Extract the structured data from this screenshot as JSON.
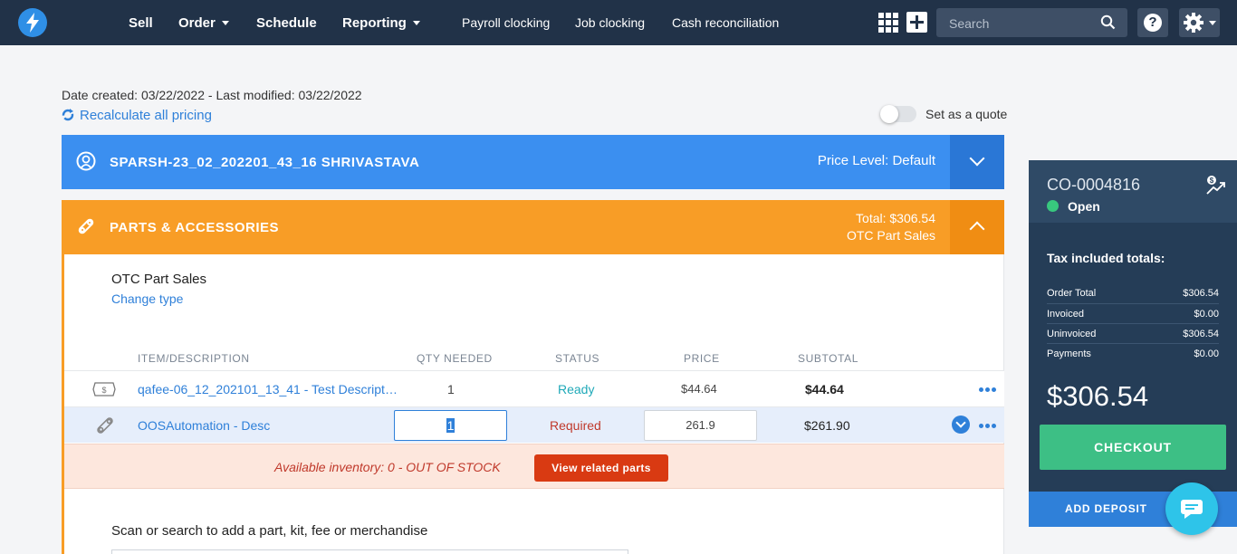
{
  "nav": {
    "main": [
      {
        "label": "Sell",
        "dropdown": false
      },
      {
        "label": "Order",
        "dropdown": true
      },
      {
        "label": "Schedule",
        "dropdown": false
      },
      {
        "label": "Reporting",
        "dropdown": true
      }
    ],
    "secondary": [
      "Payroll clocking",
      "Job clocking",
      "Cash reconciliation"
    ],
    "search_placeholder": "Search",
    "help_label": "?",
    "icons": [
      "lightning-logo-icon",
      "apps-grid-icon",
      "plus-icon",
      "search-icon",
      "help-icon",
      "gear-icon"
    ]
  },
  "meta": {
    "dates": "Date created: 03/22/2022 - Last modified: 03/22/2022",
    "recalculate": "Recalculate all pricing",
    "quote_label": "Set as a quote",
    "quote_enabled": false
  },
  "customer": {
    "name": "SPARSH-23_02_202201_43_16 SHRIVASTAVA",
    "price_level": "Price Level: Default"
  },
  "parts": {
    "title": "PARTS & ACCESSORIES",
    "total": "Total: $306.54",
    "sale_type": "OTC Part Sales",
    "type_title": "OTC Part Sales",
    "change_type": "Change type",
    "columns": [
      "ITEM/DESCRIPTION",
      "QTY NEEDED",
      "STATUS",
      "PRICE",
      "SUBTOTAL"
    ],
    "rows": [
      {
        "item": "qafee-06_12_202101_13_41 - Test Descript…",
        "qty": "1",
        "status": "Ready",
        "price": "$44.64",
        "subtotal": "$44.64"
      },
      {
        "item": "OOSAutomation - Desc",
        "qty": "1",
        "status": "Required",
        "price": "261.9",
        "subtotal": "$261.90"
      }
    ],
    "inventory_warning": "Available inventory: 0 - OUT OF STOCK",
    "related_button": "View related parts",
    "scan_label": "Scan or search to add a part, kit, fee or merchandise"
  },
  "order": {
    "id": "CO-0004816",
    "status": "Open",
    "tax_title": "Tax included totals:",
    "totals": [
      {
        "label": "Order Total",
        "value": "$306.54"
      },
      {
        "label": "Invoiced",
        "value": "$0.00"
      },
      {
        "label": "Uninvoiced",
        "value": "$306.54"
      },
      {
        "label": "Payments",
        "value": "$0.00"
      }
    ],
    "grand_total": "$306.54",
    "checkout": "CHECKOUT",
    "add_deposit": "ADD DEPOSIT"
  },
  "colors": {
    "navbar": "#213248",
    "customer_bar": "#3b8ff0",
    "parts_bar": "#f89d26",
    "ready": "#1fa9b8",
    "required": "#c0392b",
    "checkout": "#3dbf85",
    "sidebar": "#253d57"
  }
}
